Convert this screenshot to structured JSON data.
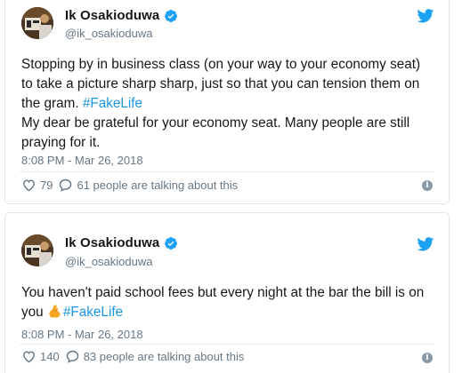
{
  "tweets": [
    {
      "name": "Ik Osakioduwa",
      "handle": "@ik_osakioduwa",
      "text_parts": [
        "Stopping by in business class (on your way to your economy seat) to take a picture sharp sharp, just so that you can tension them on the gram. ",
        "#FakeLife",
        "My dear be grateful for your economy seat. Many people are still praying for it."
      ],
      "timestamp": "8:08 PM - Mar 26, 2018",
      "likes": "79",
      "talking": "61 people are talking about this",
      "icons": [
        "avatar",
        "verified-icon",
        "twitter-bird-icon",
        "heart-icon",
        "reply-bubble-icon",
        "info-icon"
      ]
    },
    {
      "name": "Ik Osakioduwa",
      "handle": "@ik_osakioduwa",
      "text_parts": [
        "You haven't paid school fees but every night at the bar the bill is on you ",
        "#FakeLife"
      ],
      "emoji": "flexed-biceps",
      "timestamp": "8:08 PM - Mar 26, 2018",
      "likes": "140",
      "talking": "83 people are talking about this",
      "icons": [
        "avatar",
        "verified-icon",
        "twitter-bird-icon",
        "heart-icon",
        "reply-bubble-icon",
        "info-icon"
      ]
    }
  ],
  "colors": {
    "link": "#1b95e0",
    "muted": "#657786",
    "text": "#14171a",
    "border": "#e1e8ed",
    "verified": "#1da1f2",
    "emoji": "#f5a623"
  }
}
